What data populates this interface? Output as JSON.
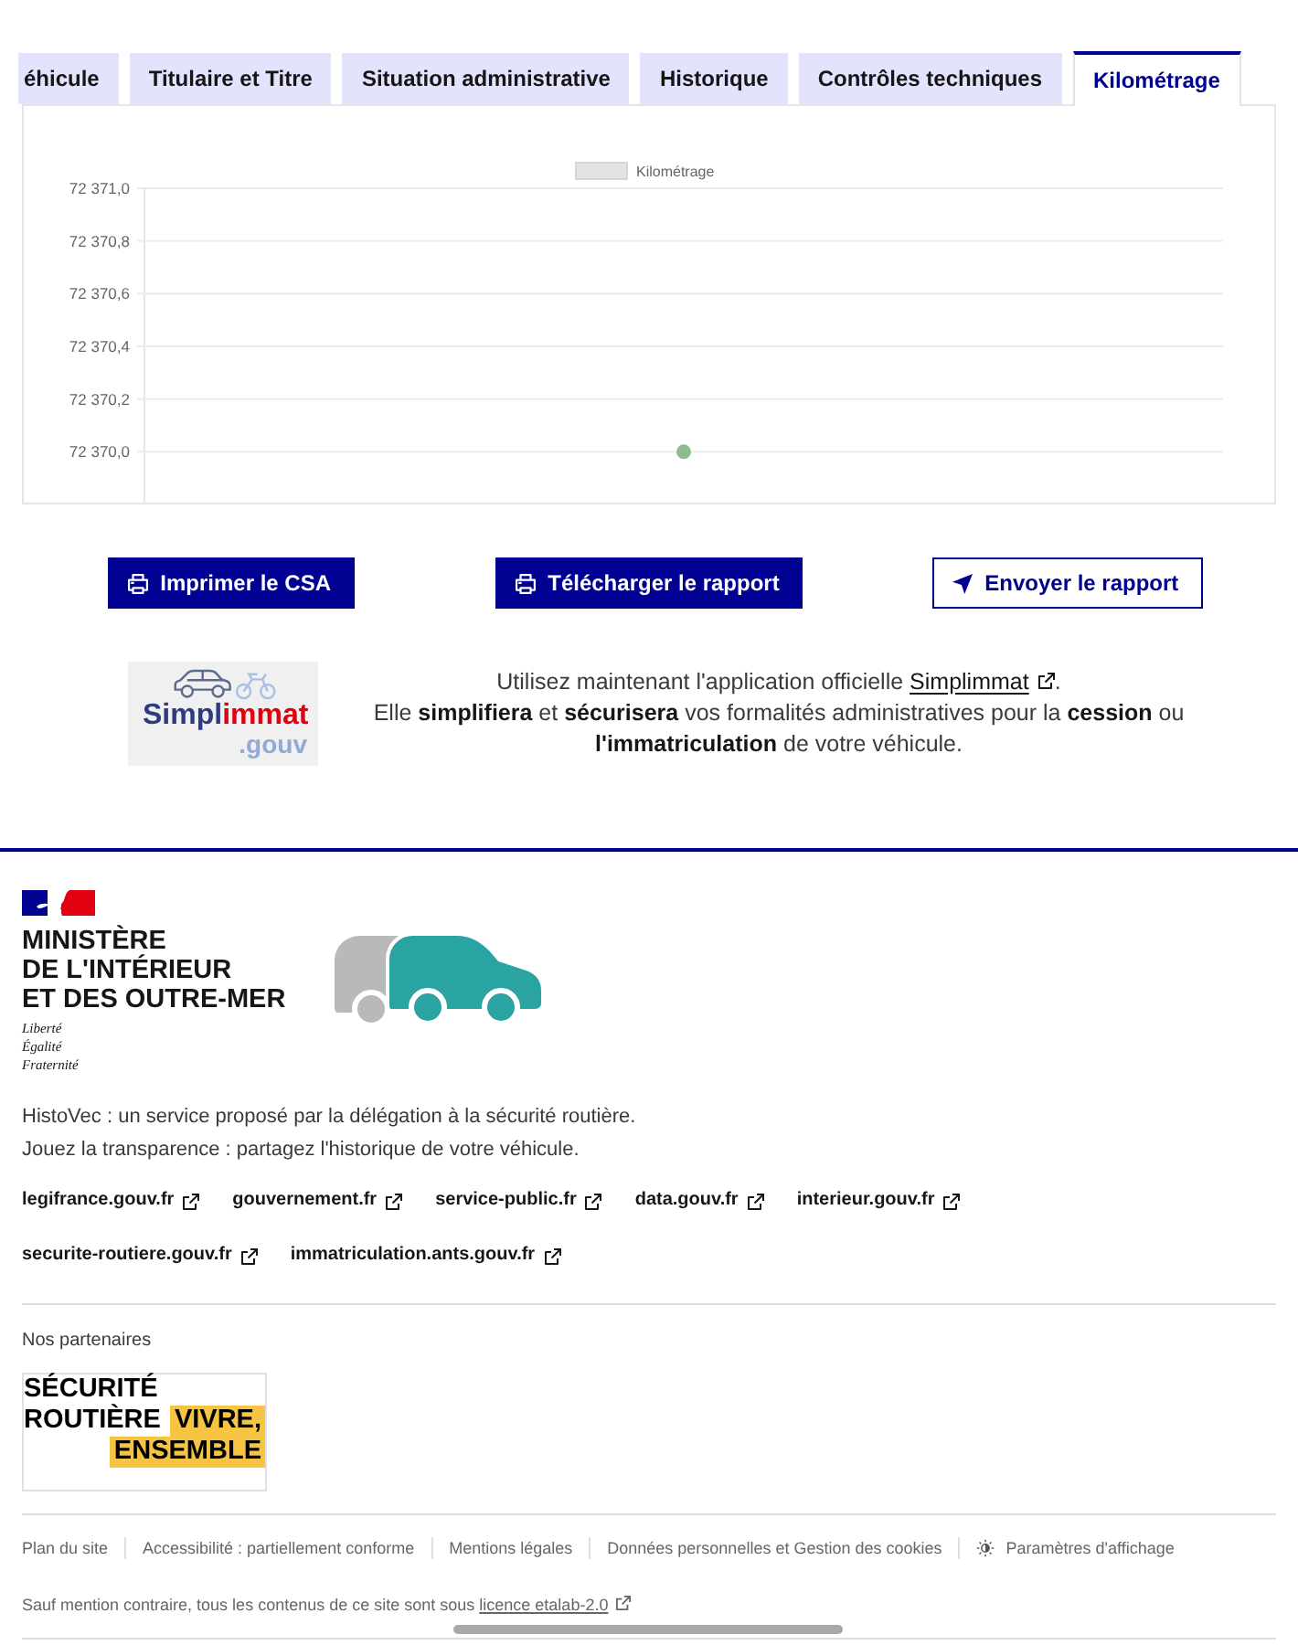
{
  "tabs": [
    {
      "label": "éhicule",
      "selected": false
    },
    {
      "label": "Titulaire et Titre",
      "selected": false
    },
    {
      "label": "Situation administrative",
      "selected": false
    },
    {
      "label": "Historique",
      "selected": false
    },
    {
      "label": "Contrôles techniques",
      "selected": false
    },
    {
      "label": "Kilométrage",
      "selected": true
    }
  ],
  "mileage_panel": {
    "chart_data": {
      "type": "scatter",
      "grid": true,
      "series": [
        {
          "name": "Kilométrage",
          "color": "#8fbc8f",
          "values": [
            72370.0
          ]
        }
      ],
      "ylim": [
        72369.8,
        72371.0
      ],
      "yticks": [
        {
          "value": 72371.0,
          "label": "72 371,0"
        },
        {
          "value": 72370.8,
          "label": "72 370,8"
        },
        {
          "value": 72370.6,
          "label": "72 370,6"
        },
        {
          "value": 72370.4,
          "label": "72 370,4"
        },
        {
          "value": 72370.2,
          "label": "72 370,2"
        },
        {
          "value": 72370.0,
          "label": "72 370,0"
        }
      ]
    }
  },
  "actions": [
    {
      "label": "Imprimer le CSA",
      "kind": "primary"
    },
    {
      "label": "Télécharger le rapport",
      "kind": "primary"
    },
    {
      "label": "Envoyer le rapport",
      "kind": "secondary"
    }
  ],
  "promo": {
    "logo": {
      "wordmark": [
        "Simpl",
        "immat"
      ],
      "suffix": ".gouv"
    },
    "intro": "Utilisez maintenant l'application officielle ",
    "link": "Simplimmat",
    "intro_end": ".",
    "body": "Elle **simplifiera** et **sécurisera** vos formalités administratives pour la **cession** ou **l'immatriculation** de votre véhicule."
  },
  "footer": {
    "ministry": [
      "MINISTÈRE",
      "DE L'INTÉRIEUR",
      "ET DES OUTRE-MER"
    ],
    "motto": [
      "Liberté",
      "Égalité",
      "Fraternité"
    ],
    "description": [
      "HistoVec : un service proposé par la délégation à la sécurité routière.",
      "Jouez la transparence : partagez l'historique de votre véhicule."
    ],
    "links": [
      "legifrance.gouv.fr",
      "gouvernement.fr",
      "service-public.fr",
      "data.gouv.fr",
      "interieur.gouv.fr",
      "securite-routiere.gouv.fr",
      "immatriculation.ants.gouv.fr"
    ],
    "partners_title": "Nos partenaires",
    "partner_logo": [
      {
        "text": "SÉCURITÉ",
        "highlight": false
      },
      {
        "text": "ROUTIÈRE",
        "highlight": false
      },
      {
        "text": "VIVRE,",
        "highlight": true
      },
      {
        "text": "ENSEMBLE",
        "highlight": true
      }
    ],
    "bottom_links": [
      {
        "label": "Plan du site",
        "kind": "link"
      },
      {
        "label": "Accessibilité : partiellement conforme",
        "kind": "link"
      },
      {
        "label": "Mentions légales",
        "kind": "link"
      },
      {
        "label": "Données personnelles et Gestion des cookies",
        "kind": "link"
      },
      {
        "label": "Paramètres d'affichage",
        "kind": "settings"
      }
    ],
    "license": {
      "text": "Sauf mention contraire, tous les contenus de ce site sont sous ",
      "link": "licence etalab-2.0"
    }
  }
}
